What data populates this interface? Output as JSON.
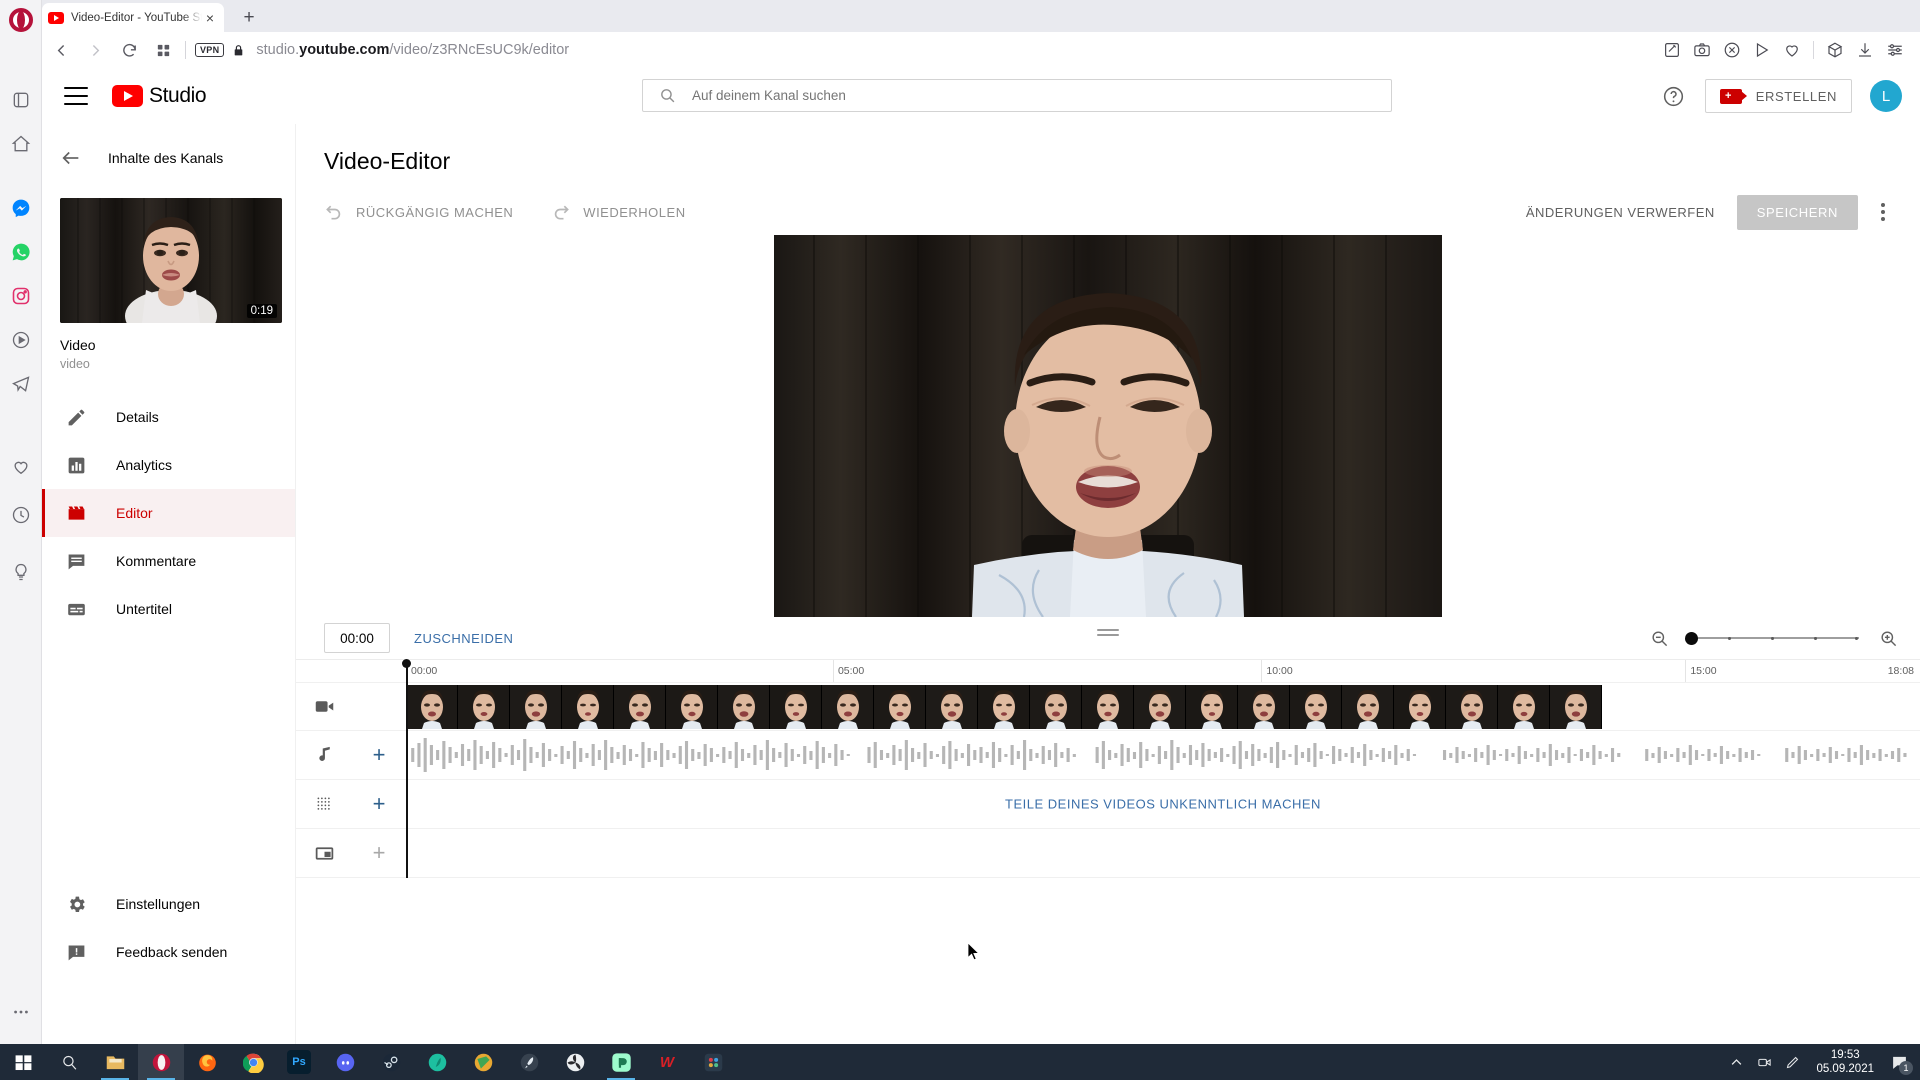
{
  "browser": {
    "name": "Opera",
    "tab": {
      "title": "Video-Editor - YouTube Stu",
      "close_label": "×"
    },
    "new_tab_label": "+",
    "vpn_label": "VPN",
    "url_prefix": "studio.",
    "url_domain": "youtube.com",
    "url_path": "/video/z3RNcEsUC9k/editor",
    "sidebar_icons": [
      "workspaces-icon",
      "speed-dial-icon",
      "messenger-icon",
      "whatsapp-icon",
      "instagram-icon",
      "music-icon",
      "telegram-icon",
      "favorites-icon",
      "history-icon",
      "tips-icon",
      "more-icon"
    ],
    "nav_icons": [
      "back-arrow-icon",
      "forward-arrow-icon",
      "reload-icon",
      "tab-overview-icon"
    ],
    "toolbar_icons": [
      "edit-page-icon",
      "snapshot-icon",
      "adblock-icon",
      "send-icon",
      "heart-icon",
      "crypto-wallet-icon",
      "downloads-icon",
      "easy-setup-icon"
    ]
  },
  "studio": {
    "logo_text": "Studio",
    "search": {
      "placeholder": "Auf deinem Kanal suchen"
    },
    "help_icon": "help-circle-icon",
    "create": {
      "label": "ERSTELLEN",
      "icon": "video-plus-icon"
    },
    "avatar": {
      "initial": "L",
      "color": "#22a7d0"
    }
  },
  "nav": {
    "back_label": "Inhalte des Kanals",
    "video": {
      "title": "Video",
      "subtitle": "video",
      "duration": "0:19"
    },
    "items": [
      {
        "label": "Details",
        "icon": "pencil-icon",
        "active": false
      },
      {
        "label": "Analytics",
        "icon": "bar-chart-icon",
        "active": false
      },
      {
        "label": "Editor",
        "icon": "clapperboard-icon",
        "active": true
      },
      {
        "label": "Kommentare",
        "icon": "comment-icon",
        "active": false
      },
      {
        "label": "Untertitel",
        "icon": "subtitles-icon",
        "active": false
      }
    ],
    "bottom_items": [
      {
        "label": "Einstellungen",
        "icon": "gear-icon"
      },
      {
        "label": "Feedback senden",
        "icon": "feedback-icon"
      }
    ]
  },
  "editor": {
    "title": "Video-Editor",
    "undo_label": "RÜCKGÄNGIG MACHEN",
    "redo_label": "WIEDERHOLEN",
    "discard_label": "ÄNDERUNGEN VERWERFEN",
    "save_label": "SPEICHERN",
    "save_disabled": true,
    "more_options_icon": "kebab-menu-icon"
  },
  "timeline": {
    "current_time": "00:00",
    "trim_label": "ZUSCHNEIDEN",
    "zoom_out_icon": "zoom-out-icon",
    "zoom_in_icon": "zoom-in-icon",
    "zoom_level": 0,
    "ruler_marks": [
      "00:00",
      "05:00",
      "10:00",
      "15:00",
      "18:08"
    ],
    "ruler_positions_pct": [
      0,
      28.2,
      56.5,
      84.5,
      100
    ],
    "tracks": [
      {
        "name": "video-track",
        "icon": "video-camera-icon",
        "add": false
      },
      {
        "name": "audio-track",
        "icon": "music-note-icon",
        "add": true,
        "add_enabled": true
      },
      {
        "name": "blur-track",
        "icon": "blur-grid-icon",
        "add": true,
        "add_enabled": true,
        "label": "TEILE DEINES VIDEOS UNKENNTLICH MACHEN"
      },
      {
        "name": "end-screen-track",
        "icon": "end-screen-icon",
        "add": true,
        "add_enabled": false
      }
    ]
  },
  "taskbar": {
    "items": [
      {
        "name": "start-button",
        "icon": "windows-icon"
      },
      {
        "name": "search-button",
        "icon": "search-icon"
      },
      {
        "name": "file-explorer",
        "icon": "folder-icon"
      },
      {
        "name": "opera",
        "icon": "opera-icon"
      },
      {
        "name": "firefox",
        "icon": "firefox-icon"
      },
      {
        "name": "chrome",
        "icon": "chrome-icon"
      },
      {
        "name": "photoshop",
        "icon": "photoshop-icon",
        "label": "Ps"
      },
      {
        "name": "discord",
        "icon": "discord-icon"
      },
      {
        "name": "steam",
        "icon": "steam-icon"
      },
      {
        "name": "app-teal",
        "icon": "leaf-icon"
      },
      {
        "name": "app-green-book",
        "icon": "book-icon"
      },
      {
        "name": "app-rocket",
        "icon": "rocket-icon"
      },
      {
        "name": "app-fan",
        "icon": "fan-icon"
      },
      {
        "name": "app-mint",
        "icon": "mint-icon"
      },
      {
        "name": "app-wondershare",
        "icon": "w-icon",
        "label": "W"
      },
      {
        "name": "app-davinci",
        "icon": "davinci-icon"
      }
    ],
    "tray": {
      "chevron": "show-hidden-icon",
      "icons": [
        "camera-tray-icon",
        "pen-tray-icon"
      ]
    },
    "clock": {
      "time": "19:53",
      "date": "05.09.2021"
    },
    "notifications": {
      "count": "1"
    }
  }
}
